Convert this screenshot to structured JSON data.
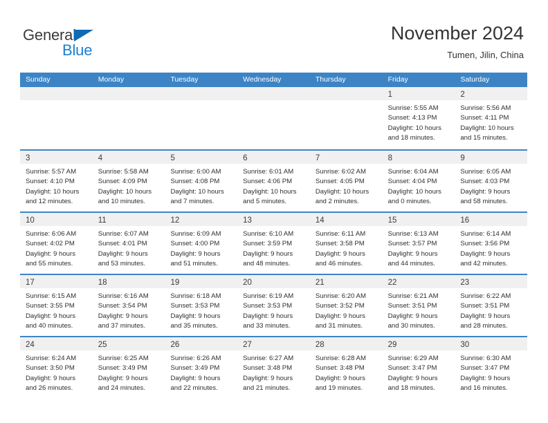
{
  "brand": {
    "name_part1": "General",
    "name_part2": "Blue",
    "triangle_color": "#0f6ab4",
    "blue_color": "#1b7fd1"
  },
  "header": {
    "title": "November 2024",
    "location": "Tumen, Jilin, China"
  },
  "theme": {
    "header_blue": "#3c84c6",
    "day_strip_gray": "#f0f0f0",
    "text_color": "#2e2e2e"
  },
  "weekdays": [
    {
      "label": "Sunday"
    },
    {
      "label": "Monday"
    },
    {
      "label": "Tuesday"
    },
    {
      "label": "Wednesday"
    },
    {
      "label": "Thursday"
    },
    {
      "label": "Friday"
    },
    {
      "label": "Saturday"
    }
  ],
  "weeks": [
    [
      {
        "day": "",
        "lines": []
      },
      {
        "day": "",
        "lines": []
      },
      {
        "day": "",
        "lines": []
      },
      {
        "day": "",
        "lines": []
      },
      {
        "day": "",
        "lines": []
      },
      {
        "day": "1",
        "lines": [
          "Sunrise: 5:55 AM",
          "Sunset: 4:13 PM",
          "Daylight: 10 hours",
          "and 18 minutes."
        ]
      },
      {
        "day": "2",
        "lines": [
          "Sunrise: 5:56 AM",
          "Sunset: 4:11 PM",
          "Daylight: 10 hours",
          "and 15 minutes."
        ]
      }
    ],
    [
      {
        "day": "3",
        "lines": [
          "Sunrise: 5:57 AM",
          "Sunset: 4:10 PM",
          "Daylight: 10 hours",
          "and 12 minutes."
        ]
      },
      {
        "day": "4",
        "lines": [
          "Sunrise: 5:58 AM",
          "Sunset: 4:09 PM",
          "Daylight: 10 hours",
          "and 10 minutes."
        ]
      },
      {
        "day": "5",
        "lines": [
          "Sunrise: 6:00 AM",
          "Sunset: 4:08 PM",
          "Daylight: 10 hours",
          "and 7 minutes."
        ]
      },
      {
        "day": "6",
        "lines": [
          "Sunrise: 6:01 AM",
          "Sunset: 4:06 PM",
          "Daylight: 10 hours",
          "and 5 minutes."
        ]
      },
      {
        "day": "7",
        "lines": [
          "Sunrise: 6:02 AM",
          "Sunset: 4:05 PM",
          "Daylight: 10 hours",
          "and 2 minutes."
        ]
      },
      {
        "day": "8",
        "lines": [
          "Sunrise: 6:04 AM",
          "Sunset: 4:04 PM",
          "Daylight: 10 hours",
          "and 0 minutes."
        ]
      },
      {
        "day": "9",
        "lines": [
          "Sunrise: 6:05 AM",
          "Sunset: 4:03 PM",
          "Daylight: 9 hours",
          "and 58 minutes."
        ]
      }
    ],
    [
      {
        "day": "10",
        "lines": [
          "Sunrise: 6:06 AM",
          "Sunset: 4:02 PM",
          "Daylight: 9 hours",
          "and 55 minutes."
        ]
      },
      {
        "day": "11",
        "lines": [
          "Sunrise: 6:07 AM",
          "Sunset: 4:01 PM",
          "Daylight: 9 hours",
          "and 53 minutes."
        ]
      },
      {
        "day": "12",
        "lines": [
          "Sunrise: 6:09 AM",
          "Sunset: 4:00 PM",
          "Daylight: 9 hours",
          "and 51 minutes."
        ]
      },
      {
        "day": "13",
        "lines": [
          "Sunrise: 6:10 AM",
          "Sunset: 3:59 PM",
          "Daylight: 9 hours",
          "and 48 minutes."
        ]
      },
      {
        "day": "14",
        "lines": [
          "Sunrise: 6:11 AM",
          "Sunset: 3:58 PM",
          "Daylight: 9 hours",
          "and 46 minutes."
        ]
      },
      {
        "day": "15",
        "lines": [
          "Sunrise: 6:13 AM",
          "Sunset: 3:57 PM",
          "Daylight: 9 hours",
          "and 44 minutes."
        ]
      },
      {
        "day": "16",
        "lines": [
          "Sunrise: 6:14 AM",
          "Sunset: 3:56 PM",
          "Daylight: 9 hours",
          "and 42 minutes."
        ]
      }
    ],
    [
      {
        "day": "17",
        "lines": [
          "Sunrise: 6:15 AM",
          "Sunset: 3:55 PM",
          "Daylight: 9 hours",
          "and 40 minutes."
        ]
      },
      {
        "day": "18",
        "lines": [
          "Sunrise: 6:16 AM",
          "Sunset: 3:54 PM",
          "Daylight: 9 hours",
          "and 37 minutes."
        ]
      },
      {
        "day": "19",
        "lines": [
          "Sunrise: 6:18 AM",
          "Sunset: 3:53 PM",
          "Daylight: 9 hours",
          "and 35 minutes."
        ]
      },
      {
        "day": "20",
        "lines": [
          "Sunrise: 6:19 AM",
          "Sunset: 3:53 PM",
          "Daylight: 9 hours",
          "and 33 minutes."
        ]
      },
      {
        "day": "21",
        "lines": [
          "Sunrise: 6:20 AM",
          "Sunset: 3:52 PM",
          "Daylight: 9 hours",
          "and 31 minutes."
        ]
      },
      {
        "day": "22",
        "lines": [
          "Sunrise: 6:21 AM",
          "Sunset: 3:51 PM",
          "Daylight: 9 hours",
          "and 30 minutes."
        ]
      },
      {
        "day": "23",
        "lines": [
          "Sunrise: 6:22 AM",
          "Sunset: 3:51 PM",
          "Daylight: 9 hours",
          "and 28 minutes."
        ]
      }
    ],
    [
      {
        "day": "24",
        "lines": [
          "Sunrise: 6:24 AM",
          "Sunset: 3:50 PM",
          "Daylight: 9 hours",
          "and 26 minutes."
        ]
      },
      {
        "day": "25",
        "lines": [
          "Sunrise: 6:25 AM",
          "Sunset: 3:49 PM",
          "Daylight: 9 hours",
          "and 24 minutes."
        ]
      },
      {
        "day": "26",
        "lines": [
          "Sunrise: 6:26 AM",
          "Sunset: 3:49 PM",
          "Daylight: 9 hours",
          "and 22 minutes."
        ]
      },
      {
        "day": "27",
        "lines": [
          "Sunrise: 6:27 AM",
          "Sunset: 3:48 PM",
          "Daylight: 9 hours",
          "and 21 minutes."
        ]
      },
      {
        "day": "28",
        "lines": [
          "Sunrise: 6:28 AM",
          "Sunset: 3:48 PM",
          "Daylight: 9 hours",
          "and 19 minutes."
        ]
      },
      {
        "day": "29",
        "lines": [
          "Sunrise: 6:29 AM",
          "Sunset: 3:47 PM",
          "Daylight: 9 hours",
          "and 18 minutes."
        ]
      },
      {
        "day": "30",
        "lines": [
          "Sunrise: 6:30 AM",
          "Sunset: 3:47 PM",
          "Daylight: 9 hours",
          "and 16 minutes."
        ]
      }
    ]
  ]
}
